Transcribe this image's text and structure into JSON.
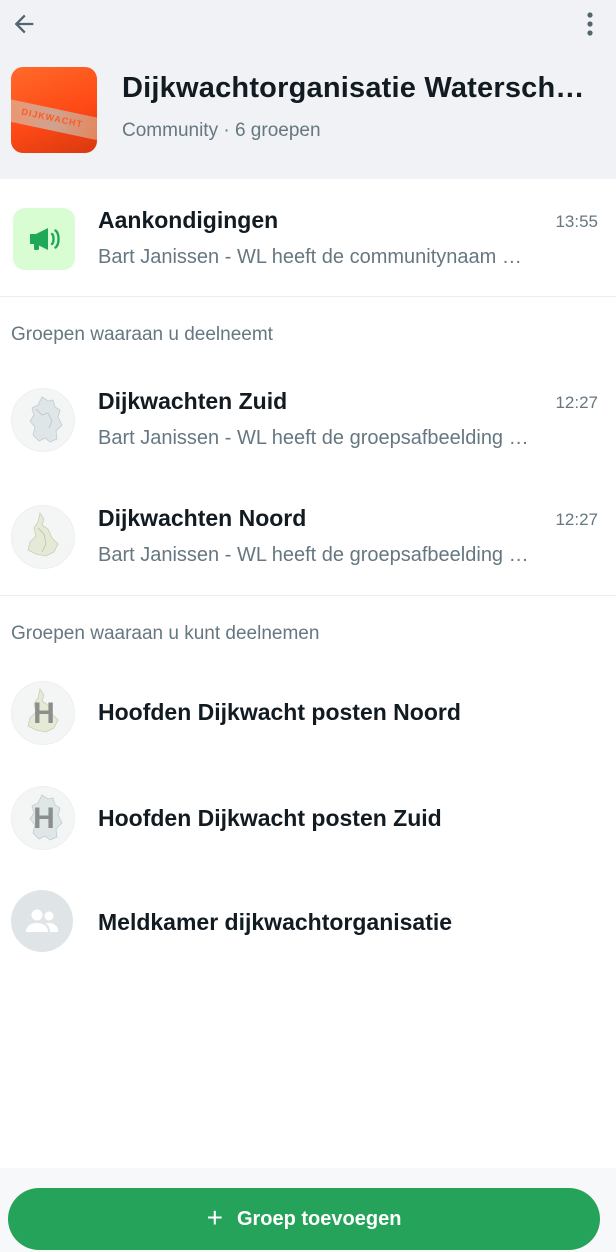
{
  "header": {
    "title": "Dijkwachtorganisatie Watersch…",
    "subtitle": "Community · 6 groepen",
    "avatar_text": "DIJKWACHT",
    "back_icon": "arrow-left-icon",
    "more_icon": "more-vertical-icon"
  },
  "announcements": {
    "title": "Aankondigingen",
    "time": "13:55",
    "preview": "Bart Janissen - WL heeft de communitynaam …",
    "icon": "megaphone-icon"
  },
  "sections": {
    "joined_label": "Groepen waaraan u deelneemt",
    "joinable_label": "Groepen waaraan u kunt deelnemen"
  },
  "joined_groups": [
    {
      "title": "Dijkwachten Zuid",
      "time": "12:27",
      "preview": "Bart Janissen - WL heeft de groepsafbeelding …"
    },
    {
      "title": "Dijkwachten Noord",
      "time": "12:27",
      "preview": "Bart Janissen - WL heeft de groepsafbeelding …"
    }
  ],
  "joinable_groups": [
    {
      "title": "Hoofden Dijkwacht posten Noord",
      "avatar_letter": "H"
    },
    {
      "title": "Hoofden Dijkwacht posten Zuid",
      "avatar_letter": "H"
    },
    {
      "title": "Meldkamer dijkwachtorganisatie",
      "icon": "group-icon"
    }
  ],
  "footer": {
    "add_button_label": "Groep toevoegen",
    "add_icon": "+"
  },
  "colors": {
    "accent": "#25a35a",
    "header_bg": "#f0f2f5",
    "announce_bg": "#d9fdd3",
    "announce_fg": "#1fa855",
    "muted_text": "#667781"
  }
}
